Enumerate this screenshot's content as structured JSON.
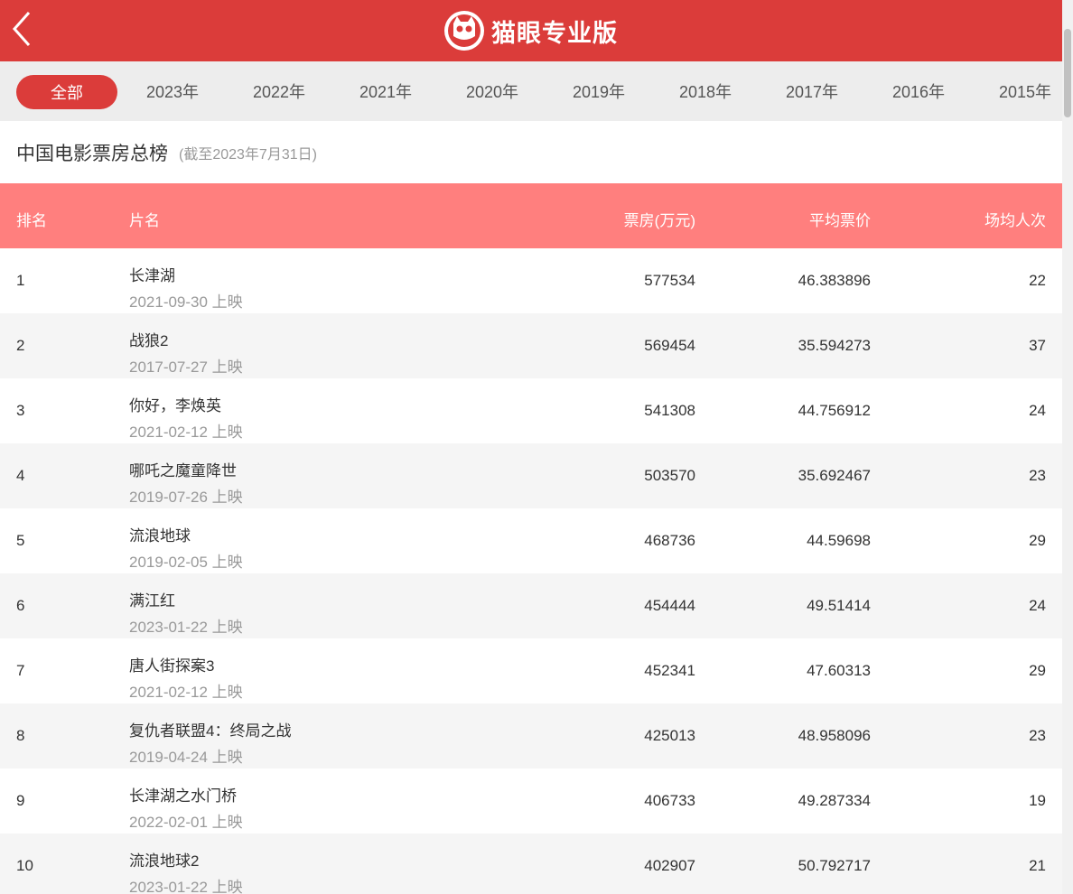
{
  "header": {
    "brand": "猫眼专业版"
  },
  "filters": {
    "active": "全部",
    "years": [
      "2023年",
      "2022年",
      "2021年",
      "2020年",
      "2019年",
      "2018年",
      "2017年",
      "2016年",
      "2015年"
    ]
  },
  "board": {
    "title": "中国电影票房总榜",
    "subtitle": "(截至2023年7月31日)"
  },
  "table": {
    "headers": {
      "rank": "排名",
      "name": "片名",
      "box": "票房(万元)",
      "avg": "平均票价",
      "ppl": "场均人次"
    },
    "rows": [
      {
        "rank": "1",
        "name": "长津湖",
        "date": "2021-09-30 上映",
        "box": "577534",
        "avg": "46.383896",
        "ppl": "22"
      },
      {
        "rank": "2",
        "name": "战狼2",
        "date": "2017-07-27 上映",
        "box": "569454",
        "avg": "35.594273",
        "ppl": "37"
      },
      {
        "rank": "3",
        "name": "你好，李焕英",
        "date": "2021-02-12 上映",
        "box": "541308",
        "avg": "44.756912",
        "ppl": "24"
      },
      {
        "rank": "4",
        "name": "哪吒之魔童降世",
        "date": "2019-07-26 上映",
        "box": "503570",
        "avg": "35.692467",
        "ppl": "23"
      },
      {
        "rank": "5",
        "name": "流浪地球",
        "date": "2019-02-05 上映",
        "box": "468736",
        "avg": "44.59698",
        "ppl": "29"
      },
      {
        "rank": "6",
        "name": "满江红",
        "date": "2023-01-22 上映",
        "box": "454444",
        "avg": "49.51414",
        "ppl": "24"
      },
      {
        "rank": "7",
        "name": "唐人街探案3",
        "date": "2021-02-12 上映",
        "box": "452341",
        "avg": "47.60313",
        "ppl": "29"
      },
      {
        "rank": "8",
        "name": "复仇者联盟4：终局之战",
        "date": "2019-04-24 上映",
        "box": "425013",
        "avg": "48.958096",
        "ppl": "23"
      },
      {
        "rank": "9",
        "name": "长津湖之水门桥",
        "date": "2022-02-01 上映",
        "box": "406733",
        "avg": "49.287334",
        "ppl": "19"
      },
      {
        "rank": "10",
        "name": "流浪地球2",
        "date": "2023-01-22 上映",
        "box": "402907",
        "avg": "50.792717",
        "ppl": "21"
      }
    ]
  }
}
